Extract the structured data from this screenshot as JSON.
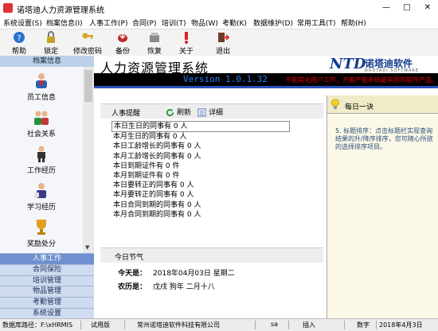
{
  "window": {
    "title": "诺塔迪人力资源管理系统",
    "minimize": "—",
    "maximize": "□",
    "close": "✕"
  },
  "menu": [
    "系统设置(S)",
    "档案信息(I)",
    "人事工作(P)",
    "合同(P)",
    "培训(T)",
    "物品(W)",
    "考勤(K)",
    "数据维护(D)",
    "常用工具(T)",
    "帮助(H)"
  ],
  "toolbar": [
    {
      "label": "帮助",
      "icon": "help-icon"
    },
    {
      "label": "锁定",
      "icon": "lock-icon"
    },
    {
      "label": "修改密码",
      "icon": "key-icon"
    },
    {
      "label": "备份",
      "icon": "backup-icon"
    },
    {
      "label": "恢复",
      "icon": "restore-icon"
    },
    {
      "label": "关于",
      "icon": "about-icon"
    },
    {
      "label": "退出",
      "icon": "exit-icon"
    }
  ],
  "sidebar": {
    "header": "档案信息",
    "items": [
      {
        "label": "员工信息",
        "icon": "employee-icon"
      },
      {
        "label": "社会关系",
        "icon": "social-relations-icon"
      },
      {
        "label": "工作经历",
        "icon": "work-experience-icon"
      },
      {
        "label": "学习经历",
        "icon": "study-experience-icon"
      },
      {
        "label": "奖励处分",
        "icon": "trophy-icon"
      }
    ],
    "categories": [
      "人事工作",
      "合同保险",
      "培训管理",
      "物品管理",
      "考勤管理",
      "系统设置"
    ],
    "active_category": "人事工作"
  },
  "header": {
    "title": "人力资源管理系统",
    "logo_mark": "NTD",
    "logo_text": "诺塔迪软件",
    "logo_sub": "NUOTADI SOFTWARE",
    "version": "Version 1.0.1.32",
    "warning": "不能简化用户工作，方案产能系统最有限的软件产品。"
  },
  "reminders": {
    "title": "人事提醒",
    "refresh": "刷新",
    "detail": "详细",
    "items": [
      "本日生日的同事有 0 人",
      "本月生日的同事有 0 人",
      "本日工龄增长的同事有 0 人",
      "本月工龄增长的同事有 0 人",
      "本日到期证件有 0 件",
      "本月到期证件有 0 件",
      "本日要转正的同事有 0 人",
      "本月要转正的同事有 0 人",
      "本日合同到期的同事有 0 人",
      "本月合同到期的同事有 0 人"
    ]
  },
  "festival": {
    "title": "今日节气",
    "today_label": "今天是：",
    "today_value": "2018年04月03日 星期二",
    "lunar_label": "农历是：",
    "lunar_value": "戊戌 狗年 二月十八"
  },
  "tip": {
    "title": "每日一诀",
    "body": "5. 标题排序：点击标题栏实现查询结果的升/降序排序，您可随心所欲的选择排序项目。"
  },
  "status": {
    "db_path": "数据库路径：F:\\xHRMIS",
    "mode": "试用版",
    "company": "常州诺塔迪软件科技有限公司",
    "user": "sa",
    "insert": "插入",
    "numlock": "数字",
    "date": "2018年4月3日"
  }
}
